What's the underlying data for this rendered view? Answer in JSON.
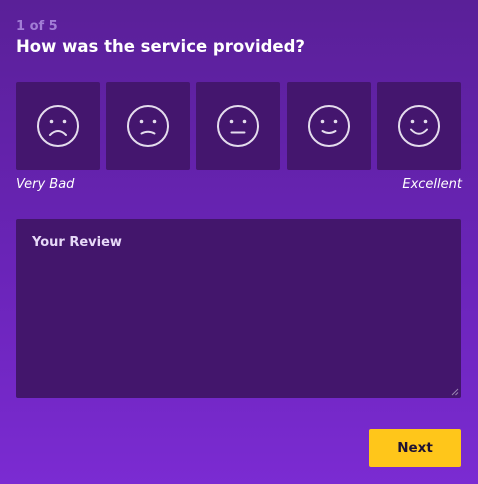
{
  "survey": {
    "step": "1 of 5",
    "question": "How was the service provided?"
  },
  "ratings": {
    "options": [
      {
        "icon": "sad-face-icon"
      },
      {
        "icon": "slightly-sad-face-icon"
      },
      {
        "icon": "neutral-face-icon"
      },
      {
        "icon": "slightly-happy-face-icon"
      },
      {
        "icon": "happy-face-icon"
      }
    ],
    "scale_low": "Very Bad",
    "scale_high": "Excellent"
  },
  "review": {
    "placeholder": "Your Review",
    "value": ""
  },
  "actions": {
    "next_label": "Next"
  },
  "colors": {
    "background": "#6a24b8",
    "tile": "#44166e",
    "accent_button": "#ffc61a",
    "step_text": "#a27dd6"
  }
}
